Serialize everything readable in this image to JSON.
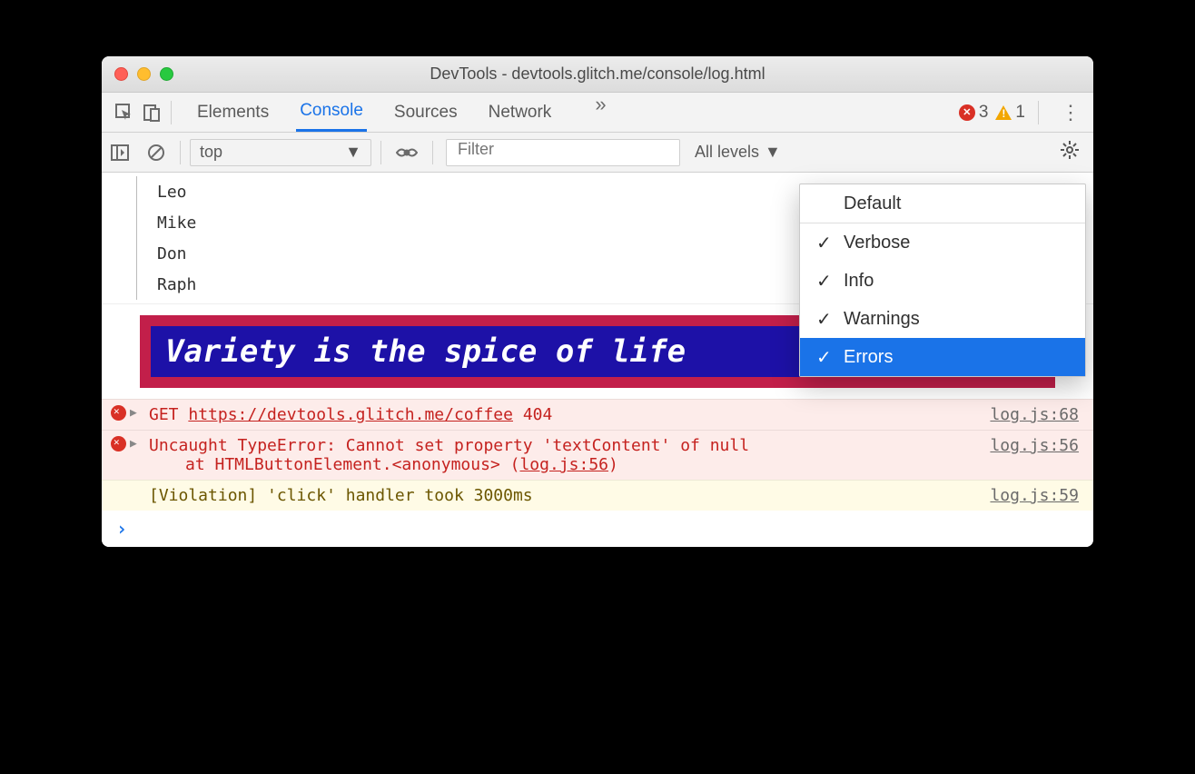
{
  "window": {
    "title": "DevTools - devtools.glitch.me/console/log.html"
  },
  "tabs": {
    "items": [
      "Elements",
      "Console",
      "Sources",
      "Network"
    ],
    "active_index": 1,
    "more_glyph": "»",
    "error_count": "3",
    "warn_count": "1"
  },
  "toolbar": {
    "context": "top",
    "filter_placeholder": "Filter",
    "levels_label": "All levels"
  },
  "levels_menu": {
    "header": "Default",
    "items": [
      {
        "label": "Verbose",
        "checked": true,
        "selected": false
      },
      {
        "label": "Info",
        "checked": true,
        "selected": false
      },
      {
        "label": "Warnings",
        "checked": true,
        "selected": false
      },
      {
        "label": "Errors",
        "checked": true,
        "selected": true
      }
    ]
  },
  "console": {
    "tree_items": [
      "Leo",
      "Mike",
      "Don",
      "Raph"
    ],
    "styled_message": "Variety is the spice of life",
    "errors": [
      {
        "prefix": "GET",
        "url": "https://devtools.glitch.me/coffee",
        "status": "404",
        "source": "log.js:68"
      },
      {
        "line1": "Uncaught TypeError: Cannot set property 'textContent' of null",
        "line2_prefix": "at HTMLButtonElement.<anonymous> (",
        "line2_link": "log.js:56",
        "line2_suffix": ")",
        "source": "log.js:56"
      }
    ],
    "violation": {
      "text": "[Violation] 'click' handler took 3000ms",
      "source": "log.js:59"
    },
    "prompt": "›"
  }
}
